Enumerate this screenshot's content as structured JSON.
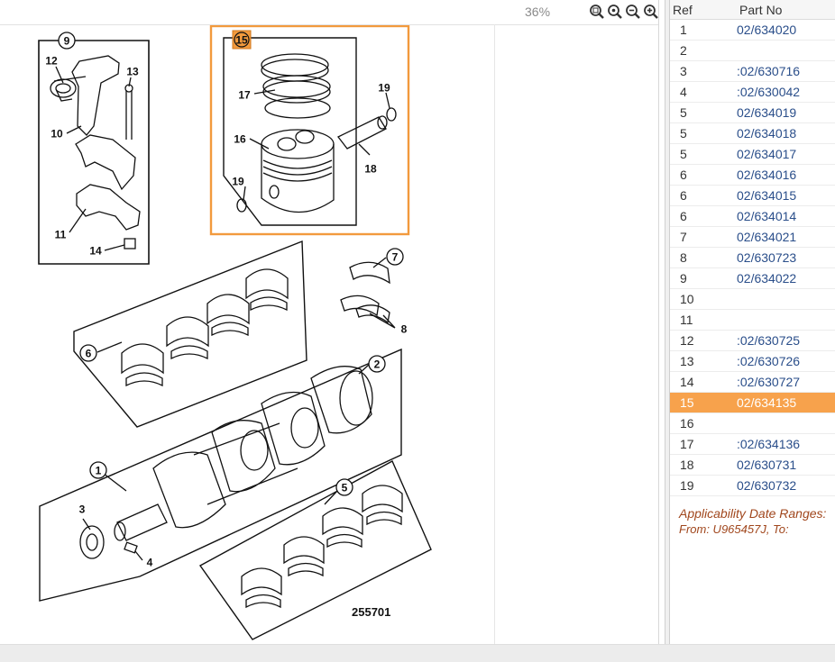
{
  "viewer": {
    "zoom_text": "36%",
    "toolbar": [
      {
        "name": "zoom-fit-icon"
      },
      {
        "name": "zoom-actual-icon"
      },
      {
        "name": "zoom-out-icon"
      },
      {
        "name": "zoom-in-icon"
      }
    ],
    "highlight_color": "#f29a3d",
    "drawing_number": "255701",
    "callouts": [
      "9",
      "12",
      "13",
      "10",
      "11",
      "14",
      "15",
      "17",
      "16",
      "19",
      "18",
      "19",
      "7",
      "8",
      "6",
      "2",
      "1",
      "3",
      "4",
      "5"
    ]
  },
  "parts_table": {
    "headers": {
      "ref": "Ref",
      "part_no": "Part No"
    },
    "rows": [
      {
        "ref": "1",
        "part_no": "02/634020"
      },
      {
        "ref": "2",
        "part_no": ""
      },
      {
        "ref": "3",
        "part_no": ":02/630716"
      },
      {
        "ref": "4",
        "part_no": ":02/630042"
      },
      {
        "ref": "5",
        "part_no": "02/634019"
      },
      {
        "ref": "5",
        "part_no": "02/634018"
      },
      {
        "ref": "5",
        "part_no": "02/634017"
      },
      {
        "ref": "6",
        "part_no": "02/634016"
      },
      {
        "ref": "6",
        "part_no": "02/634015"
      },
      {
        "ref": "6",
        "part_no": "02/634014"
      },
      {
        "ref": "7",
        "part_no": "02/634021"
      },
      {
        "ref": "8",
        "part_no": "02/630723"
      },
      {
        "ref": "9",
        "part_no": "02/634022"
      },
      {
        "ref": "10",
        "part_no": ""
      },
      {
        "ref": "11",
        "part_no": ""
      },
      {
        "ref": "12",
        "part_no": ":02/630725"
      },
      {
        "ref": "13",
        "part_no": ":02/630726"
      },
      {
        "ref": "14",
        "part_no": ":02/630727"
      },
      {
        "ref": "15",
        "part_no": "02/634135",
        "selected": true
      },
      {
        "ref": "16",
        "part_no": ""
      },
      {
        "ref": "17",
        "part_no": ":02/634136"
      },
      {
        "ref": "18",
        "part_no": "02/630731"
      },
      {
        "ref": "19",
        "part_no": "02/630732"
      }
    ],
    "selected_color": "#f7a24c"
  },
  "applicability": {
    "title": "Applicability Date Ranges:",
    "range": "From: U965457J, To:"
  }
}
